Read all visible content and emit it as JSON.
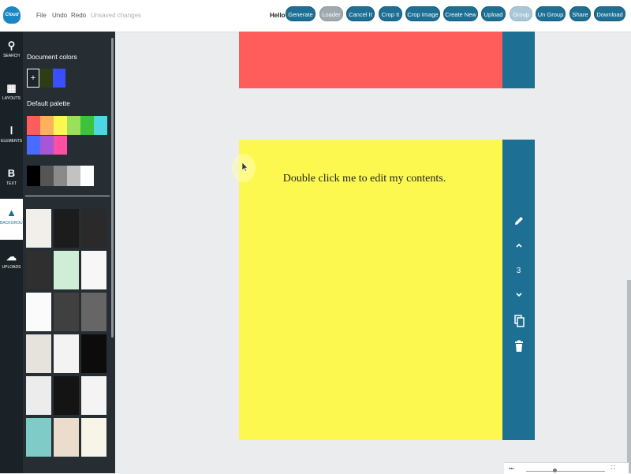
{
  "app": {
    "logo_text": "Cloud"
  },
  "menu": {
    "file": "File",
    "undo": "Undo",
    "redo": "Redo",
    "status": "Unsaved changes"
  },
  "user": {
    "greeting": "Hello"
  },
  "toolbar": {
    "generate": "Generate",
    "loader": "Loader",
    "cancel_it": "Cancel It",
    "crop_it": "Crop It",
    "crop_image": "Crop Image",
    "create_new": "Create New",
    "upload": "Upload",
    "group": "Group",
    "un_group": "Un Group",
    "share": "Share",
    "download": "Download"
  },
  "rail": [
    {
      "label": "SEARCH",
      "icon": "search-icon",
      "glyph": "⚲"
    },
    {
      "label": "LAYOUTS",
      "icon": "layouts-icon",
      "glyph": "▦"
    },
    {
      "label": "ELEMENTS",
      "icon": "elements-icon",
      "glyph": "Ⅰ"
    },
    {
      "label": "TEXT",
      "icon": "text-icon",
      "glyph": "B"
    },
    {
      "label": "BACKGROUND",
      "icon": "background-icon",
      "glyph": "▲",
      "active": true
    },
    {
      "label": "UPLOADS",
      "icon": "uploads-icon",
      "glyph": "☁"
    }
  ],
  "panel": {
    "document_colors_title": "Document colors",
    "add_color_symbol": "+",
    "document_colors": [
      "#2e3d14",
      "#3a4fff"
    ],
    "default_palette_title": "Default palette",
    "default_palette": [
      "#ff5c5c",
      "#ffb25c",
      "#fdf84f",
      "#9be05a",
      "#3cc23c",
      "#4bd8e3",
      "#4a6bff",
      "#a855d8",
      "#ff4fa3"
    ],
    "grayscale": [
      "#000000",
      "#555555",
      "#8a8a8a",
      "#c2c2c2",
      "#ffffff"
    ],
    "backgrounds": [
      "#f2efea",
      "#1c1c1c",
      "#2a2a2a",
      "#2f2f2f",
      "#cfeed6",
      "#f7f7f7",
      "#fbfbfb",
      "#404040",
      "#666666",
      "#e6e2dc",
      "#f3f3f3",
      "#0c0c0c",
      "#ececec",
      "#141414",
      "#f4f4f4",
      "#7fcbc7",
      "#ebdccb",
      "#f6f5e8"
    ]
  },
  "canvas": {
    "pages": [
      {
        "color": "#ff5c5c"
      },
      {
        "color": "#fdf84f",
        "text": "Double click me to edit my contents."
      }
    ],
    "controls": {
      "page_number": "3"
    }
  },
  "colors": {
    "accent": "#1d6f93",
    "rail_bg": "#1a2127",
    "panel_bg": "#262d33"
  }
}
